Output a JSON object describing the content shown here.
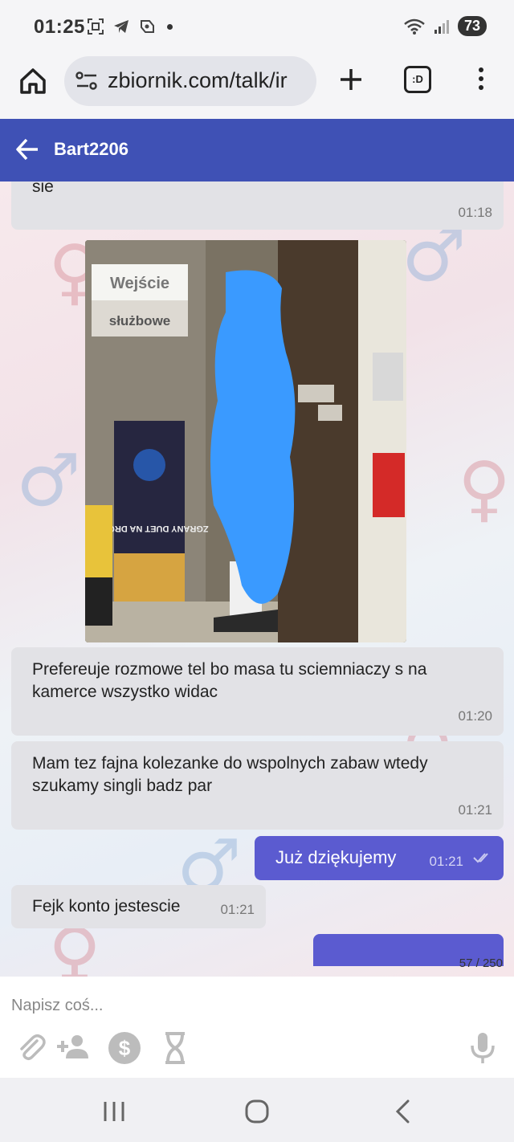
{
  "status_bar": {
    "time": "01:25",
    "battery": "73"
  },
  "browser": {
    "url": "zbiornik.com/talk/ir",
    "tabs_label": ":D"
  },
  "header": {
    "title": "Bart2206"
  },
  "messages": [
    {
      "text": "sie",
      "time": "01:18",
      "direction": "in"
    },
    {
      "text": "Prefereuje rozmowe tel bo masa tu sciemniaczy s na kamerce wszystko widac",
      "time": "01:20",
      "direction": "in"
    },
    {
      "text": "Mam tez fajna kolezanke do wspolnych zabaw wtedy szukamy singli badz par",
      "time": "01:21",
      "direction": "in"
    },
    {
      "text": "Już dziękujemy",
      "time": "01:21",
      "direction": "out"
    },
    {
      "text": "Fejk konto jestescie",
      "time": "01:21",
      "direction": "in"
    }
  ],
  "photo": {
    "sign_line1": "Wejście",
    "sign_line2": "służbowe",
    "stand_text": "ZGRANY DUET NA DRODZE"
  },
  "counter": "57 / 250",
  "input": {
    "placeholder": "Napisz coś..."
  },
  "icons": {
    "attach": "paperclip-icon",
    "add_person": "add-person-icon",
    "money": "dollar-icon",
    "timer": "hourglass-icon",
    "mic": "microphone-icon"
  },
  "colors": {
    "header": "#3f51b5",
    "outgoing_bubble": "#5b5bd0",
    "incoming_bubble": "#e2e2e6",
    "censor_blue": "#3a9aff"
  }
}
